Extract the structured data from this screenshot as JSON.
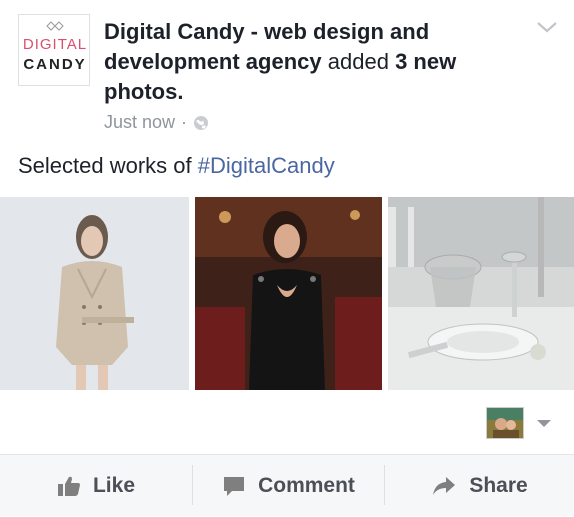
{
  "post": {
    "logo_text_top": "DIGITAL",
    "logo_text_bottom": "CANDY",
    "page_name": "Digital Candy - web design and development agency",
    "action_text": "added",
    "photo_count_text": "3 new photos.",
    "timestamp": "Just now",
    "meta_separator": "·",
    "privacy_icon": "globe-icon",
    "caption_text": "Selected works of ",
    "hashtag": "#DigitalCandy"
  },
  "photos": [
    {
      "name": "woman-in-trench-coat"
    },
    {
      "name": "woman-in-black-dress"
    },
    {
      "name": "table-setting"
    }
  ],
  "actions": {
    "like_label": "Like",
    "comment_label": "Comment",
    "share_label": "Share",
    "like_icon": "thumbs-up-icon",
    "comment_icon": "speech-bubble-icon",
    "share_icon": "share-arrow-icon"
  },
  "colors": {
    "link": "#4b67a1",
    "meta": "#90949c",
    "brand_pink": "#d9506f",
    "action_text": "#4b4f56"
  }
}
